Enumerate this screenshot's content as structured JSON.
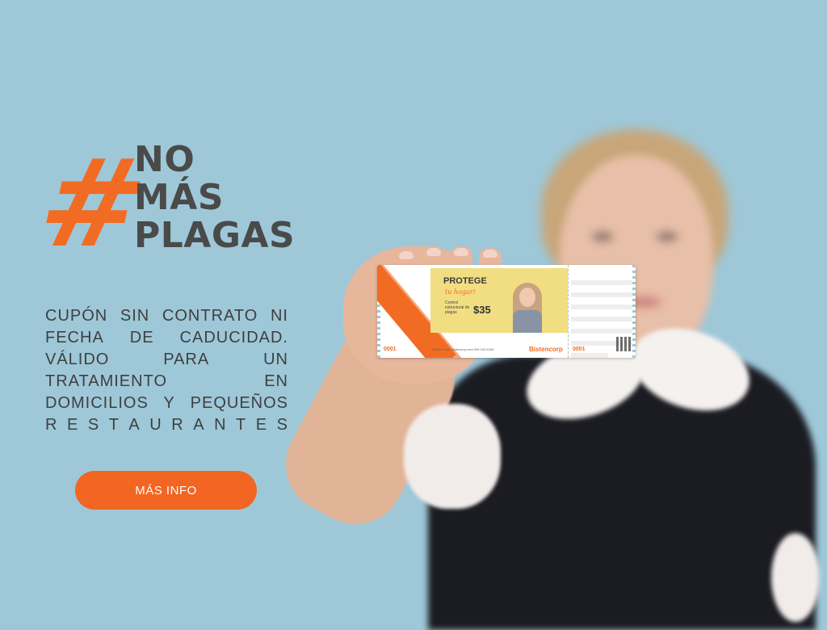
{
  "hero": {
    "hashtag": "#",
    "headline_lines": [
      "NO",
      "MÁS",
      "PLAGAS"
    ],
    "description_lines": [
      [
        "CUPÓN",
        "SIN",
        "CONTRATO",
        "NI"
      ],
      [
        "FECHA",
        "DE",
        "CADUCIDAD."
      ],
      [
        "VÁLIDO",
        "PARA",
        "UN"
      ],
      [
        "TRATAMIENTO",
        "EN"
      ],
      [
        "DOMICILIOS",
        "Y",
        "PEQUEÑOS"
      ],
      [
        "R",
        "E",
        "S",
        "T",
        "A",
        "U",
        "R",
        "A",
        "N",
        "T",
        "E",
        "S"
      ]
    ],
    "cta_label": "MÁS INFO"
  },
  "coupon": {
    "title": "PROTEGE",
    "subtitle": "tu hogar!",
    "description": "Control estructural de plagas",
    "price": "$35",
    "serial": "0001",
    "contacts": "@bistencorp   bistencorp.com   099 163 6258",
    "brand": "Bistencorp"
  },
  "colors": {
    "background": "#9ec8d8",
    "accent": "#f26522",
    "headline": "#4a4a4a"
  }
}
